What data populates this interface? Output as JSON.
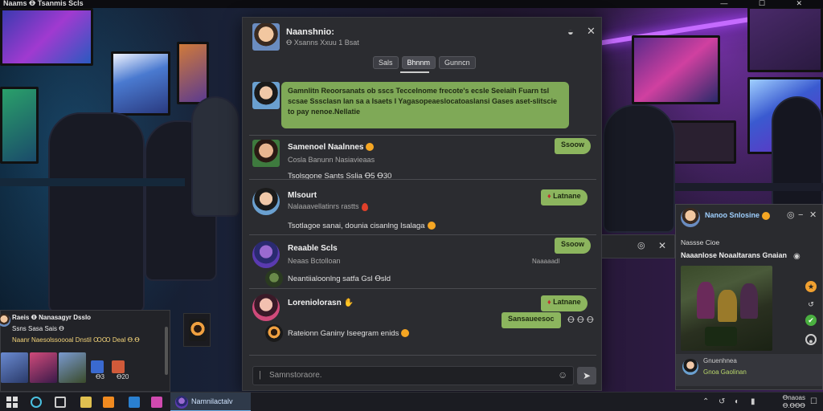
{
  "app": {
    "title": "Naams  Ꝋ  Tsanmis  Scls",
    "window_controls": "— ☐ ✕"
  },
  "chat": {
    "header": {
      "name": "Naanshnio:",
      "status": "Ꝋ  Xsanns Xxuu  1 Bsat"
    },
    "tabs": [
      {
        "label": "Sals",
        "active": false
      },
      {
        "label": "Bhnnm",
        "active": true
      },
      {
        "label": "Gunncn",
        "active": false
      }
    ],
    "pinned": {
      "text": "Gamnlitn Reoorsanats ob sscs Teccelnome frecote's ecsle Seeiaih Fuarn tsl scsae Sssclasn lan sa a Isaets I Yagasopeaeslocatoaslansi Gases aset-slitscie to pay nenoe.Nellatie"
    },
    "messages": [
      {
        "sender": "Samenoel Naalnnes",
        "sub": "Cosla Banunn Nasiavieaas",
        "line": "Tsolsgone Sants  Sslia  Ꝋ5  Ꝋ30",
        "pill": "Ssoow",
        "time": ""
      },
      {
        "sender": "Mlsourt",
        "sub": "Nalaaavellatinrs rastts",
        "line": "Tsotlagoe sanai,  dounia cisanlng Isalaga",
        "pill": "Latnane",
        "time": ""
      },
      {
        "sender": "Reaable Scls",
        "sub": "Neaas  Bctolloan",
        "line": "Neantiialoonlng satfa  Gsl  Ꝋsld",
        "pill": "Ssoow",
        "time": "Naaaaadl"
      },
      {
        "sender": "Loreniolorasn",
        "sub": "",
        "line": "Rateionn Ganiny Iseegram enids",
        "pill": "Latnane",
        "time": "Sansaueesoc"
      }
    ],
    "extra_time": "Ꝋ Ꝋ Ꝋ",
    "composer_placeholder": "Samnstoraore."
  },
  "right_window": {
    "header": "Nanoo Snlosine",
    "line1": "Nassse Cioe",
    "line2": "Naaanlose Noaaltarans Gnaian",
    "footer_name": "Gnuenhnea",
    "footer_status": "Gnoa Gaolinan"
  },
  "left_window": {
    "line1": "Raeis  Ꝋ  Nanasagyr  Dsslo",
    "line2": "Ssns Sasa Sais  Ꝋ",
    "line3": "Naanr  Naesolssoooal  Dnstil  ꝎꝎ  Deal  Ꝋ.Ꝋ",
    "count1": "Ꝋ3",
    "count2": "Ꝋ20"
  },
  "taskbar": {
    "active_app": "Namnilactalv",
    "clock_line1": "Ꝋnaoas",
    "clock_line2": "Ꝋ.ꝊꝊꝊ"
  }
}
